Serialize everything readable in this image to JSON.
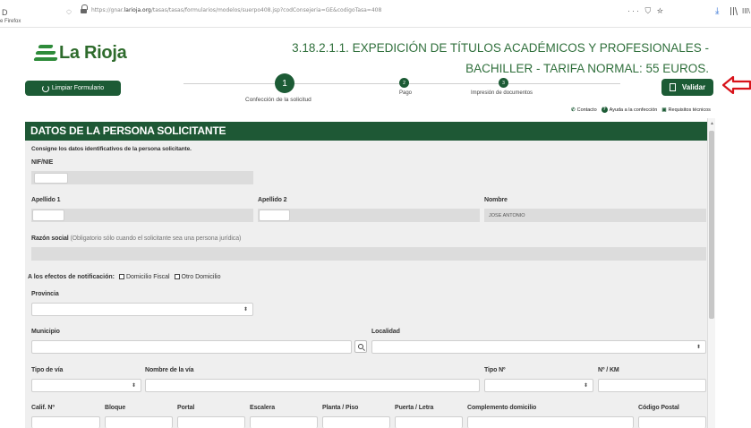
{
  "browser": {
    "url_prefix": "https://gnar.",
    "url_domain": "larioja.org",
    "url_rest": "/tasas/tasas/formularios/modelos/suerpo408.jsp?codConsejeria=GE&codigoTasa=408",
    "menu_icons": "··· ⛉ ☆",
    "left_edge": "D",
    "right_edge": "III\\",
    "label": "e Firefox"
  },
  "header": {
    "logo_text": "La Rioja",
    "title": "3.18.2.1.1. EXPEDICIÓN DE TÍTULOS ACADÉMICOS Y PROFESIONALES - BACHILLER - TARIFA NORMAL: 55 EUROS."
  },
  "toolbar": {
    "reset_label": "Limpiar Formulario",
    "validate_label": "Validar"
  },
  "steps": [
    {
      "number": "1",
      "label": "Confección de la solicitud"
    },
    {
      "number": "2",
      "label": "Pago"
    },
    {
      "number": "3",
      "label": "Impresión de documentos"
    }
  ],
  "help": {
    "contact": "Contacto",
    "help_confection": "Ayuda a la confección",
    "tech_requirements": "Requisitos técnicos"
  },
  "form": {
    "section_title": "DATOS DE LA PERSONA SOLICITANTE",
    "intro": "Consigne los datos identificativos de la persona solicitante.",
    "nif_label": "NIF/NIE",
    "apellido1_label": "Apellido 1",
    "apellido2_label": "Apellido 2",
    "nombre_label": "Nombre",
    "nombre_value": "JOSE ANTONIO",
    "razon_label": "Razón social",
    "razon_hint": "(Obligatorio sólo cuando el solicitante sea una persona jurídica)",
    "notif_label": "A los efectos de notificación:",
    "notif_fiscal": "Domicilio Fiscal",
    "notif_otro": "Otro Domicilio",
    "provincia_label": "Provincia",
    "municipio_label": "Municipio",
    "localidad_label": "Localidad",
    "tipo_via_label": "Tipo de vía",
    "nombre_via_label": "Nombre de la vía",
    "tipo_num_label": "Tipo Nº",
    "num_km_label": "Nº / KM",
    "calif_label": "Calif. Nº",
    "bloque_label": "Bloque",
    "portal_label": "Portal",
    "escalera_label": "Escalera",
    "planta_label": "Planta / Piso",
    "puerta_label": "Puerta / Letra",
    "complemento_label": "Complemento domicilio",
    "cp_label": "Código Postal",
    "select_caret": "⬍"
  },
  "colors": {
    "brand_green": "#1e5835",
    "title_green": "#2f6f3b",
    "arrow_red": "#d8121a"
  }
}
